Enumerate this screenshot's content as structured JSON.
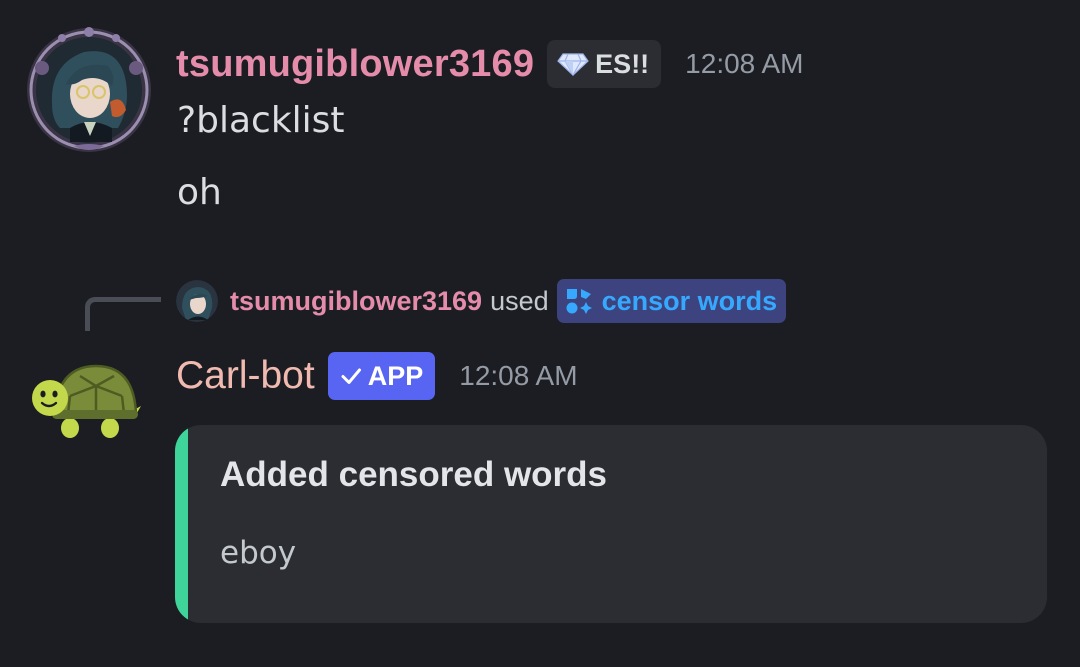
{
  "messages": [
    {
      "author": "tsumugiblower3169",
      "guild_tag": {
        "icon": "diamond-gem-icon",
        "label": "ES!!"
      },
      "timestamp": "12:08 AM",
      "lines": [
        "?blacklist",
        "oh"
      ]
    }
  ],
  "interaction": {
    "user": "tsumugiblower3169",
    "verb": "used",
    "command_icon": "slash-command-icon",
    "command": "censor words"
  },
  "bot_message": {
    "author": "Carl-bot",
    "badge": {
      "icon": "check-icon",
      "label": "APP"
    },
    "timestamp": "12:08 AM",
    "avatar_icon": "turtle-icon",
    "embed": {
      "title": "Added censored words",
      "description": "eboy",
      "accent_color": "#3fd49a"
    }
  },
  "colors": {
    "background": "#1c1d22",
    "username_pink": "#e58cab",
    "bot_name": "#f0bab1",
    "app_badge": "#5865f2",
    "command_pill": "#3c437e",
    "command_text": "#36a9ff",
    "timestamp": "#949ba4",
    "embed_bg": "#2b2d33"
  }
}
